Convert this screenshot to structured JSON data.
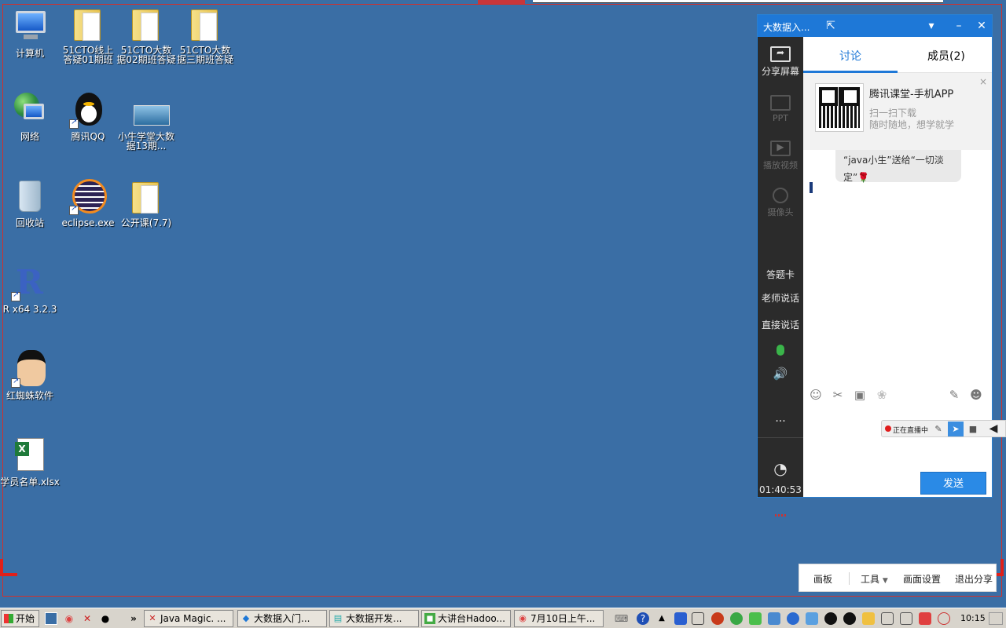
{
  "desktop": {
    "icons": [
      {
        "label": "计算机",
        "icon": "computer-icon"
      },
      {
        "label": "51CTO线上答疑01期班",
        "icon": "folder-icon"
      },
      {
        "label": "51CTO大数据02期班答疑",
        "icon": "folder-icon"
      },
      {
        "label": "51CTO大数据三期班答疑",
        "icon": "folder-icon"
      },
      {
        "label": "网络",
        "icon": "network-icon"
      },
      {
        "label": "腾讯QQ",
        "icon": "qq-icon"
      },
      {
        "label": "小牛学堂大数据13期...",
        "icon": "image-icon"
      },
      {
        "label": "回收站",
        "icon": "recycle-bin-icon"
      },
      {
        "label": "eclipse.exe",
        "icon": "eclipse-icon"
      },
      {
        "label": "公开课(7.7)",
        "icon": "folder-icon"
      },
      {
        "label": "R x64 3.2.3",
        "icon": "r-icon"
      },
      {
        "label": "红蜘蛛软件",
        "icon": "red-spider-icon"
      },
      {
        "label": "学员名单.xlsx",
        "icon": "excel-icon"
      }
    ]
  },
  "panel": {
    "title": "大数据入...",
    "sidebar": {
      "share_screen": "分享屏幕",
      "ppt": "PPT",
      "play_video": "播放视频",
      "camera": "摄像头",
      "answer_card": "答题卡",
      "teacher_talk": "老师说话",
      "direct_talk": "直接说话",
      "more": "...",
      "timer": "01:40:53"
    },
    "tabs": [
      {
        "label": "讨论",
        "active": true
      },
      {
        "label": "成员(2)",
        "active": false
      }
    ],
    "promo": {
      "title": "腾讯课堂-手机APP",
      "line1": "扫一扫下载",
      "line2": "随时随地，想学就学",
      "close": "×"
    },
    "message": {
      "text": "“java小生”送给“一切淡定”",
      "emoji": "🌹"
    },
    "send_label": "发送"
  },
  "live_bar": {
    "status": "正在直播中"
  },
  "bottom_tools": {
    "board": "画板",
    "tools": "工具",
    "screen_settings": "画面设置",
    "exit_share": "退出分享"
  },
  "taskbar": {
    "start": "开始",
    "tasks": [
      {
        "label": "Java Magic. ..."
      },
      {
        "label": "大数据入门..."
      },
      {
        "label": "大数据开发..."
      },
      {
        "label": "大讲台Hadoo..."
      },
      {
        "label": "7月10日上午..."
      }
    ],
    "clock": "10:15"
  },
  "colors": {
    "desktop": "#3a6ea5",
    "accent": "#1e78d7",
    "sidebar": "#2b2b2b",
    "share_border": "#e0201a"
  }
}
